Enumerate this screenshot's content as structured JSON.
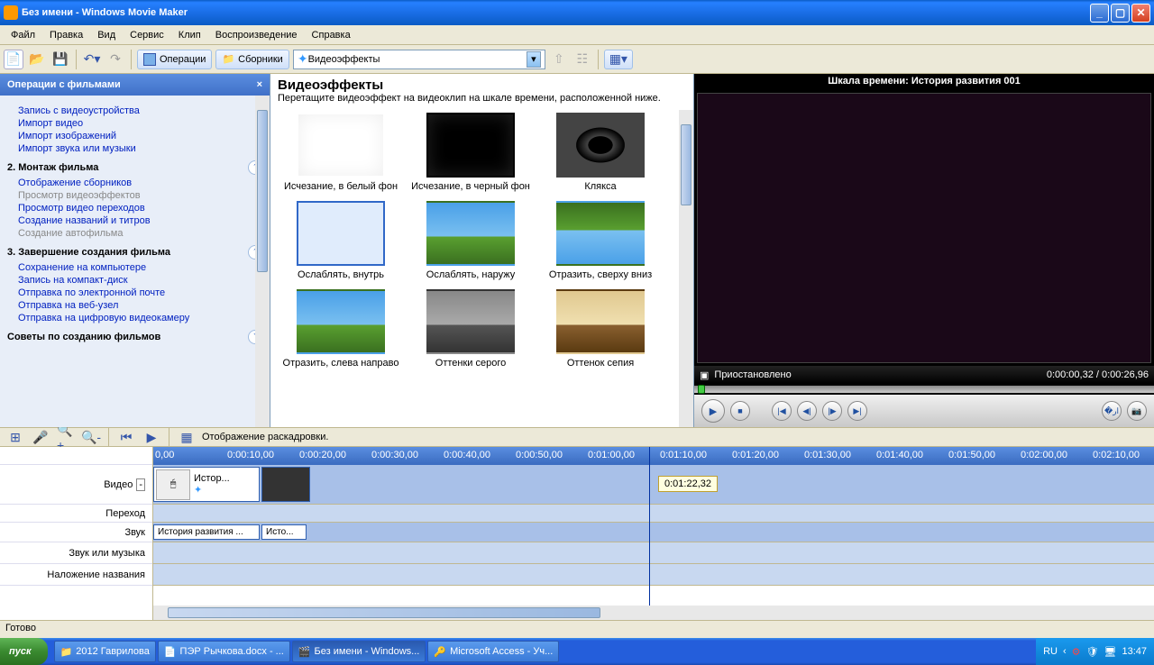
{
  "title": "Без имени - Windows Movie Maker",
  "menu": [
    "Файл",
    "Правка",
    "Вид",
    "Сервис",
    "Клип",
    "Воспроизведение",
    "Справка"
  ],
  "toolbar": {
    "operations": "Операции",
    "collections": "Сборники",
    "combo": "Видеоэффекты"
  },
  "tasks": {
    "header": "Операции с фильмами",
    "s1": [
      "Запись с видеоустройства",
      "Импорт видео",
      "Импорт изображений",
      "Импорт звука или музыки"
    ],
    "h2": "2. Монтаж фильма",
    "s2": [
      "Отображение сборников",
      "Просмотр видеоэффектов",
      "Просмотр видео переходов",
      "Создание названий и титров",
      "Создание автофильма"
    ],
    "h3": "3. Завершение создания фильма",
    "s3": [
      "Сохранение на компьютере",
      "Запись на компакт-диск",
      "Отправка по электронной почте",
      "Отправка на веб-узел",
      "Отправка на цифровую видеокамеру"
    ],
    "h4": "Советы по созданию фильмов"
  },
  "center": {
    "title": "Видеоэффекты",
    "subtitle": "Перетащите видеоэффект на видеоклип на шкале времени, расположенной ниже.",
    "row1": [
      "Исчезание, в белый фон",
      "Исчезание, в черный фон",
      "Клякса"
    ],
    "row2": [
      "Ослаблять, внутрь",
      "Ослаблять, наружу",
      "Отразить, сверху вниз"
    ],
    "row3": [
      "Отразить, слева направо",
      "Оттенки серого",
      "Оттенок сепия"
    ]
  },
  "preview": {
    "header": "Шкала времени: История развития 001",
    "status": "Приостановлено",
    "time": "0:00:00,32 / 0:00:26,96"
  },
  "timeline": {
    "toggle": "Отображение раскадровки.",
    "ticks": [
      "0,00",
      "0:00:10,00",
      "0:00:20,00",
      "0:00:30,00",
      "0:00:40,00",
      "0:00:50,00",
      "0:01:00,00",
      "0:01:10,00",
      "0:01:20,00",
      "0:01:30,00",
      "0:01:40,00",
      "0:01:50,00",
      "0:02:00,00",
      "0:02:10,00"
    ],
    "tracks": [
      "Видео",
      "Переход",
      "Звук",
      "Звук или музыка",
      "Наложение названия"
    ],
    "clip1": "Истор...",
    "marker": "0:01:22,32",
    "audio1": "История развития ...",
    "audio2": "Исто..."
  },
  "status": "Готово",
  "taskbar": {
    "start": "пуск",
    "items": [
      "2012 Гаврилова",
      "ПЭР Рычкова.docx - ...",
      "Без имени - Windows...",
      "Microsoft Access - Уч..."
    ],
    "lang": "RU",
    "clock": "13:47"
  }
}
